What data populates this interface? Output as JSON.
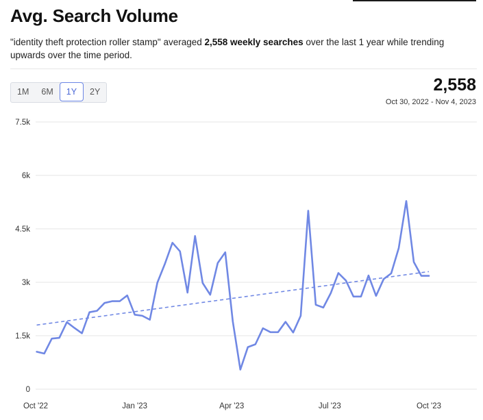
{
  "header": {
    "title": "Avg. Search Volume",
    "desc_quote": "\"identity theft protection roller stamp\"",
    "desc_mid": " averaged ",
    "desc_bold": "2,558 weekly searches",
    "desc_tail": " over the last 1 year while trending upwards over the time period."
  },
  "ranges": [
    "1M",
    "6M",
    "1Y",
    "2Y"
  ],
  "selected_range": "1Y",
  "summary": {
    "value": "2,558",
    "date_range": "Oct 30, 2022 - Nov 4, 2023"
  },
  "colors": {
    "line": "#7088e4",
    "trend": "#7088e4",
    "grid": "#e5e5e5",
    "active_button": "#6b86e6"
  },
  "chart_data": {
    "type": "line",
    "title": "",
    "xlabel": "",
    "ylabel": "",
    "ylim": [
      0,
      7500
    ],
    "yticks": [
      {
        "value": 0,
        "label": "0"
      },
      {
        "value": 1500,
        "label": "1.5k"
      },
      {
        "value": 3000,
        "label": "3k"
      },
      {
        "value": 4500,
        "label": "4.5k"
      },
      {
        "value": 6000,
        "label": "6k"
      },
      {
        "value": 7500,
        "label": "7.5k"
      }
    ],
    "xticks": [
      {
        "date": "2022-10-01",
        "label": "Oct '22"
      },
      {
        "date": "2023-01-01",
        "label": "Jan '23"
      },
      {
        "date": "2023-04-01",
        "label": "Apr '23"
      },
      {
        "date": "2023-07-01",
        "label": "Jul '23"
      },
      {
        "date": "2023-10-01",
        "label": "Oct '23"
      }
    ],
    "grid": true,
    "series": [
      {
        "values": [
          [
            "2022-10-02",
            1050
          ],
          [
            "2022-10-09",
            1000
          ],
          [
            "2022-10-16",
            1420
          ],
          [
            "2022-10-23",
            1440
          ],
          [
            "2022-10-30",
            1880
          ],
          [
            "2022-11-06",
            1720
          ],
          [
            "2022-11-13",
            1570
          ],
          [
            "2022-11-20",
            2160
          ],
          [
            "2022-11-27",
            2200
          ],
          [
            "2022-12-04",
            2420
          ],
          [
            "2022-12-11",
            2470
          ],
          [
            "2022-12-18",
            2470
          ],
          [
            "2022-12-25",
            2630
          ],
          [
            "2023-01-01",
            2090
          ],
          [
            "2023-01-08",
            2060
          ],
          [
            "2023-01-15",
            1950
          ],
          [
            "2023-01-22",
            2990
          ],
          [
            "2023-01-29",
            3520
          ],
          [
            "2023-02-05",
            4110
          ],
          [
            "2023-02-12",
            3870
          ],
          [
            "2023-02-19",
            2710
          ],
          [
            "2023-02-26",
            4300
          ],
          [
            "2023-03-05",
            2980
          ],
          [
            "2023-03-12",
            2650
          ],
          [
            "2023-03-19",
            3540
          ],
          [
            "2023-03-26",
            3840
          ],
          [
            "2023-04-02",
            1900
          ],
          [
            "2023-04-09",
            550
          ],
          [
            "2023-04-16",
            1180
          ],
          [
            "2023-04-23",
            1260
          ],
          [
            "2023-04-30",
            1710
          ],
          [
            "2023-05-07",
            1600
          ],
          [
            "2023-05-14",
            1600
          ],
          [
            "2023-05-21",
            1890
          ],
          [
            "2023-05-28",
            1590
          ],
          [
            "2023-06-04",
            2060
          ],
          [
            "2023-06-11",
            5010
          ],
          [
            "2023-06-18",
            2370
          ],
          [
            "2023-06-25",
            2290
          ],
          [
            "2023-07-02",
            2700
          ],
          [
            "2023-07-09",
            3260
          ],
          [
            "2023-07-16",
            3050
          ],
          [
            "2023-07-23",
            2600
          ],
          [
            "2023-07-30",
            2600
          ],
          [
            "2023-08-06",
            3190
          ],
          [
            "2023-08-13",
            2620
          ],
          [
            "2023-08-20",
            3090
          ],
          [
            "2023-08-27",
            3250
          ],
          [
            "2023-09-03",
            3960
          ],
          [
            "2023-09-10",
            5280
          ],
          [
            "2023-09-17",
            3570
          ],
          [
            "2023-09-24",
            3180
          ],
          [
            "2023-10-01",
            3180
          ]
        ]
      }
    ],
    "trendline": {
      "style": "dashed",
      "values": [
        [
          "2022-10-02",
          1800
        ],
        [
          "2023-10-01",
          3300
        ]
      ]
    }
  }
}
